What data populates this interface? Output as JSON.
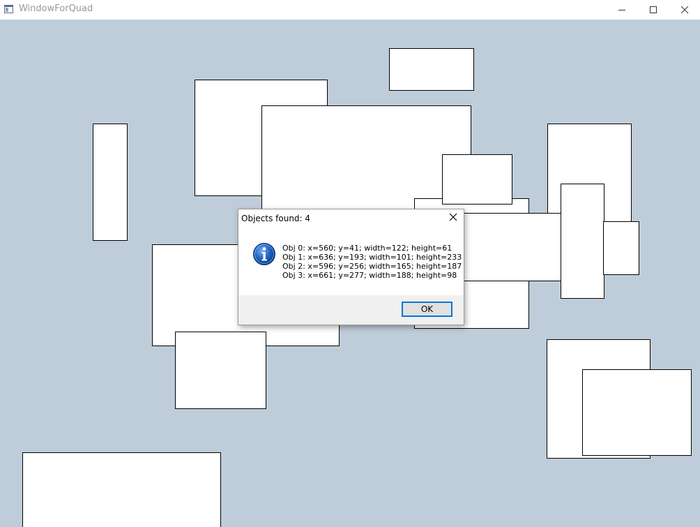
{
  "window": {
    "title": "WindowForQuad",
    "app_icon": "window-app-icon",
    "controls": [
      "minimize-icon",
      "maximize-icon",
      "close-icon"
    ]
  },
  "canvas": {
    "background_color": "#bfcdda",
    "quad_fill": "#ffffff",
    "quad_stroke": "#000000"
  },
  "dialog": {
    "title": "Objects found: 4",
    "icon": "info-icon",
    "lines": [
      "Obj 0: x=560; y=41; width=122; height=61",
      "Obj 1: x=636; y=193; width=101; height=233",
      "Obj 2: x=596; y=256; width=165; height=187",
      "Obj 3: x=661; y=277; width=188; height=98"
    ],
    "ok_label": "OK"
  }
}
